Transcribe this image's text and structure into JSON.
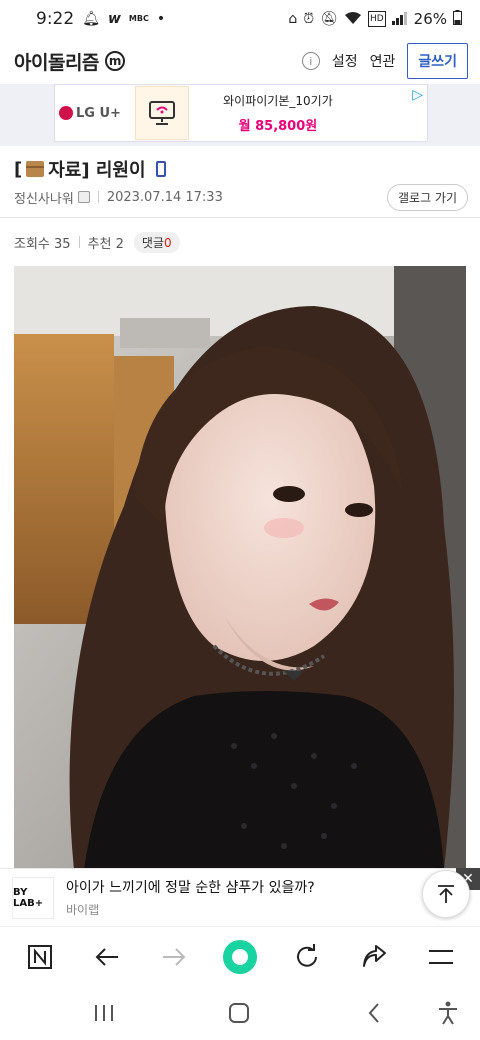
{
  "status_bar": {
    "time": "9:22",
    "battery": "26%"
  },
  "header": {
    "site_name": "아이돌리즘",
    "badge_letter": "m",
    "settings_label": "설정",
    "related_label": "연관",
    "write_label": "글쓰기"
  },
  "ad": {
    "brand": "LG U+",
    "title": "와이파이기본_10기가",
    "price": "월 85,800원"
  },
  "post": {
    "title": "[📦자료] 리원이",
    "title_text": "[자료] 리원이",
    "author": "정신사나워",
    "datetime": "2023.07.14 17:33",
    "gallery_button": "갤로그 가기",
    "views_label": "조회수 35",
    "recommend_label": "추천 2",
    "comment_label": "댓글",
    "comment_count": "0"
  },
  "bottom_ad": {
    "logo_text": "BY LAB+",
    "title": "아이가 느끼기에 정말 순한 샴푸가 있을까?",
    "brand": "바이랩"
  },
  "browser_toolbar": {
    "icons": [
      "tabs-icon",
      "back-icon",
      "forward-icon",
      "home-icon",
      "refresh-icon",
      "share-icon",
      "menu-icon"
    ]
  },
  "system_nav": {
    "icons": [
      "recent-apps-icon",
      "home-nav-icon",
      "back-nav-icon",
      "accessibility-icon"
    ]
  },
  "colors": {
    "accent_blue": "#2f5fc4",
    "price_pink": "#e8007a",
    "lgu_red": "#d0124b",
    "comment_red": "#e0241b",
    "home_green": "#19d3a0"
  }
}
